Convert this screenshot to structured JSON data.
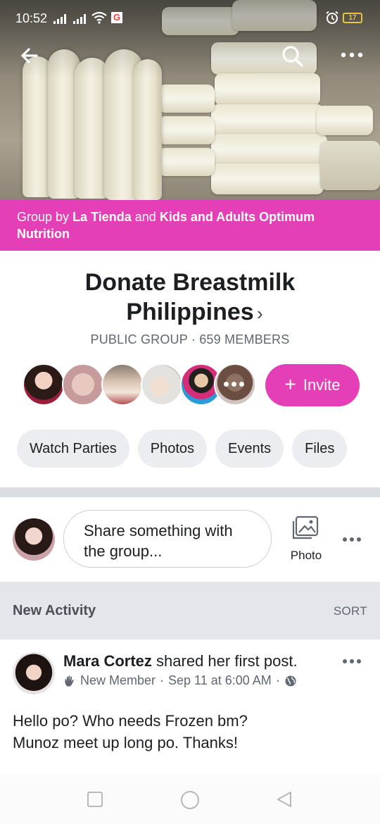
{
  "status_bar": {
    "time": "10:52",
    "battery": "17"
  },
  "banner": {
    "prefix": "Group by",
    "owner_1": "La Tienda",
    "joiner": "and",
    "owner_2": "Kids and Adults Optimum Nutrition"
  },
  "group": {
    "title": "Donate Breastmilk Philippines",
    "meta": "PUBLIC GROUP · 659 MEMBERS",
    "invite_label": "Invite"
  },
  "chips": [
    "Watch Parties",
    "Photos",
    "Events",
    "Files"
  ],
  "composer": {
    "placeholder": "Share something with the group...",
    "photo_label": "Photo"
  },
  "activity": {
    "title": "New Activity",
    "sort_label": "SORT"
  },
  "post": {
    "author": "Mara Cortez",
    "action": "shared her first post.",
    "badge": "New Member",
    "date": "Sep 11 at 6:00 AM",
    "body_line_1": "Hello po? Who needs Frozen bm?",
    "body_line_2": "Munoz meet up long po. Thanks!"
  },
  "colors": {
    "accent": "#e43fb7",
    "chip_bg": "#ebedf0",
    "activity_bg": "#e4e6eb"
  }
}
